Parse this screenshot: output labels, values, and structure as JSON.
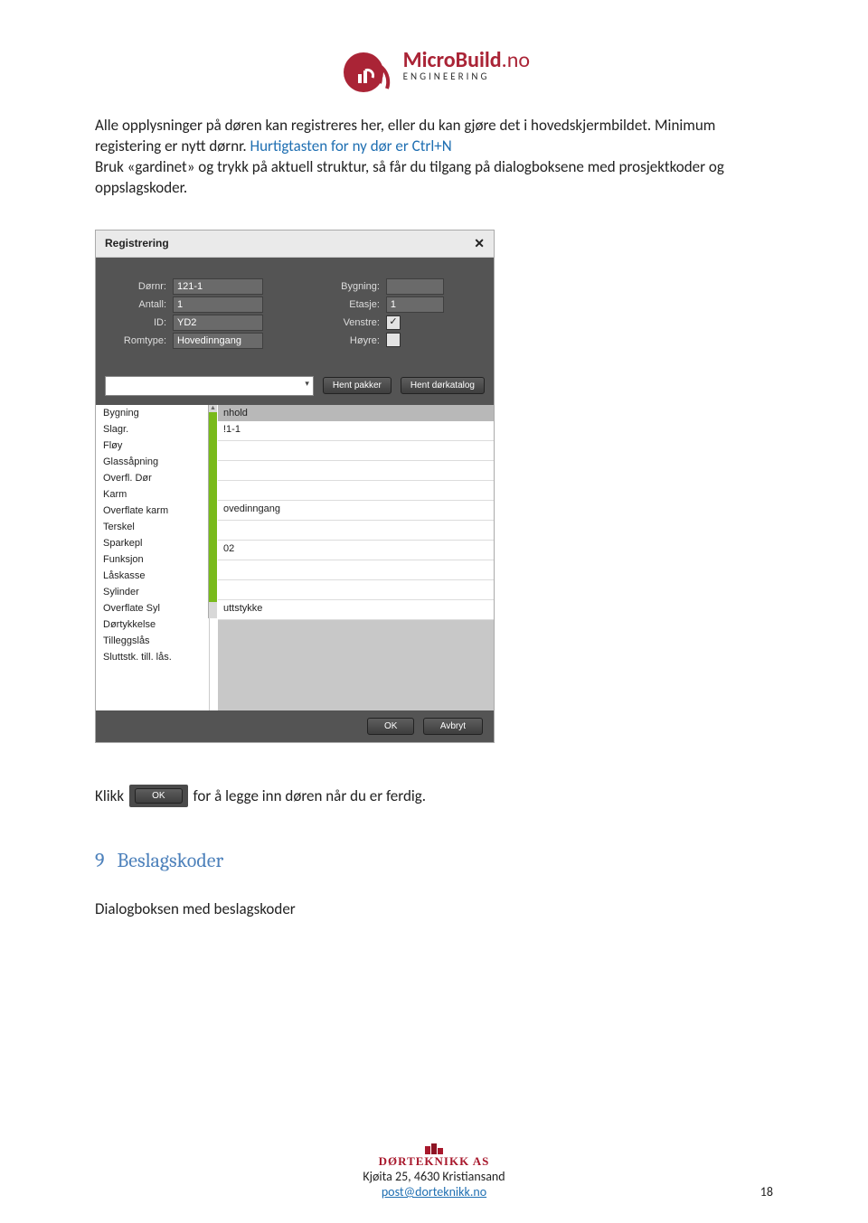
{
  "logo": {
    "brand": "MicroBuild",
    "tld": ".no",
    "sub": "ENGINEERING"
  },
  "para1a": "Alle opplysninger på døren kan registreres her, eller du kan gjøre det i hovedskjermbildet. Minimum registering er nytt dørnr. ",
  "para1b": "Hurtigtasten for ny dør er Ctrl+N",
  "para2": "Bruk «gardinet» og trykk på aktuell struktur, så får du tilgang på dialogboksene med prosjektkoder og oppslagskoder.",
  "dialog": {
    "title": "Registrering",
    "form": {
      "dornr_label": "Dørnr:",
      "dornr_value": "121-1",
      "bygning_label": "Bygning:",
      "bygning_value": "",
      "antall_label": "Antall:",
      "antall_value": "1",
      "etasje_label": "Etasje:",
      "etasje_value": "1",
      "id_label": "ID:",
      "id_value": "YD2",
      "venstre_label": "Venstre:",
      "venstre_checked": true,
      "hoyre_label": "Høyre:",
      "hoyre_checked": false,
      "romtype_label": "Romtype:",
      "romtype_value": "Hovedinngang"
    },
    "btn_hent_pakker": "Hent pakker",
    "btn_hent_katalog": "Hent dørkatalog",
    "left_list": [
      "Bygning",
      "Slagr.",
      "Fløy",
      "Glassåpning",
      "Overfl. Dør",
      "Karm",
      "Overflate karm",
      "Terskel",
      "Sparkepl",
      "Funksjon",
      "Låskasse",
      "Sylinder",
      "Overflate Syl",
      "Dørtykkelse",
      "Tilleggslås",
      "Sluttstk. till. lås."
    ],
    "grid_head": "nhold",
    "grid_rows": [
      "!1-1",
      "",
      "",
      "",
      "ovedinngang",
      "",
      "02",
      "",
      "",
      "uttstykke"
    ],
    "btn_ok": "OK",
    "btn_cancel": "Avbryt"
  },
  "klikk_before": "Klikk",
  "klikk_after": "for å legge inn døren når du er ferdig.",
  "section": {
    "num": "9",
    "title": "Beslagskoder"
  },
  "para3": "Dialogboksen med beslagskoder",
  "footer": {
    "company": "DØRTEKNIKK AS",
    "address": "Kjøita 25, 4630 Kristiansand",
    "email": "post@dorteknikk.no",
    "page": "18"
  }
}
